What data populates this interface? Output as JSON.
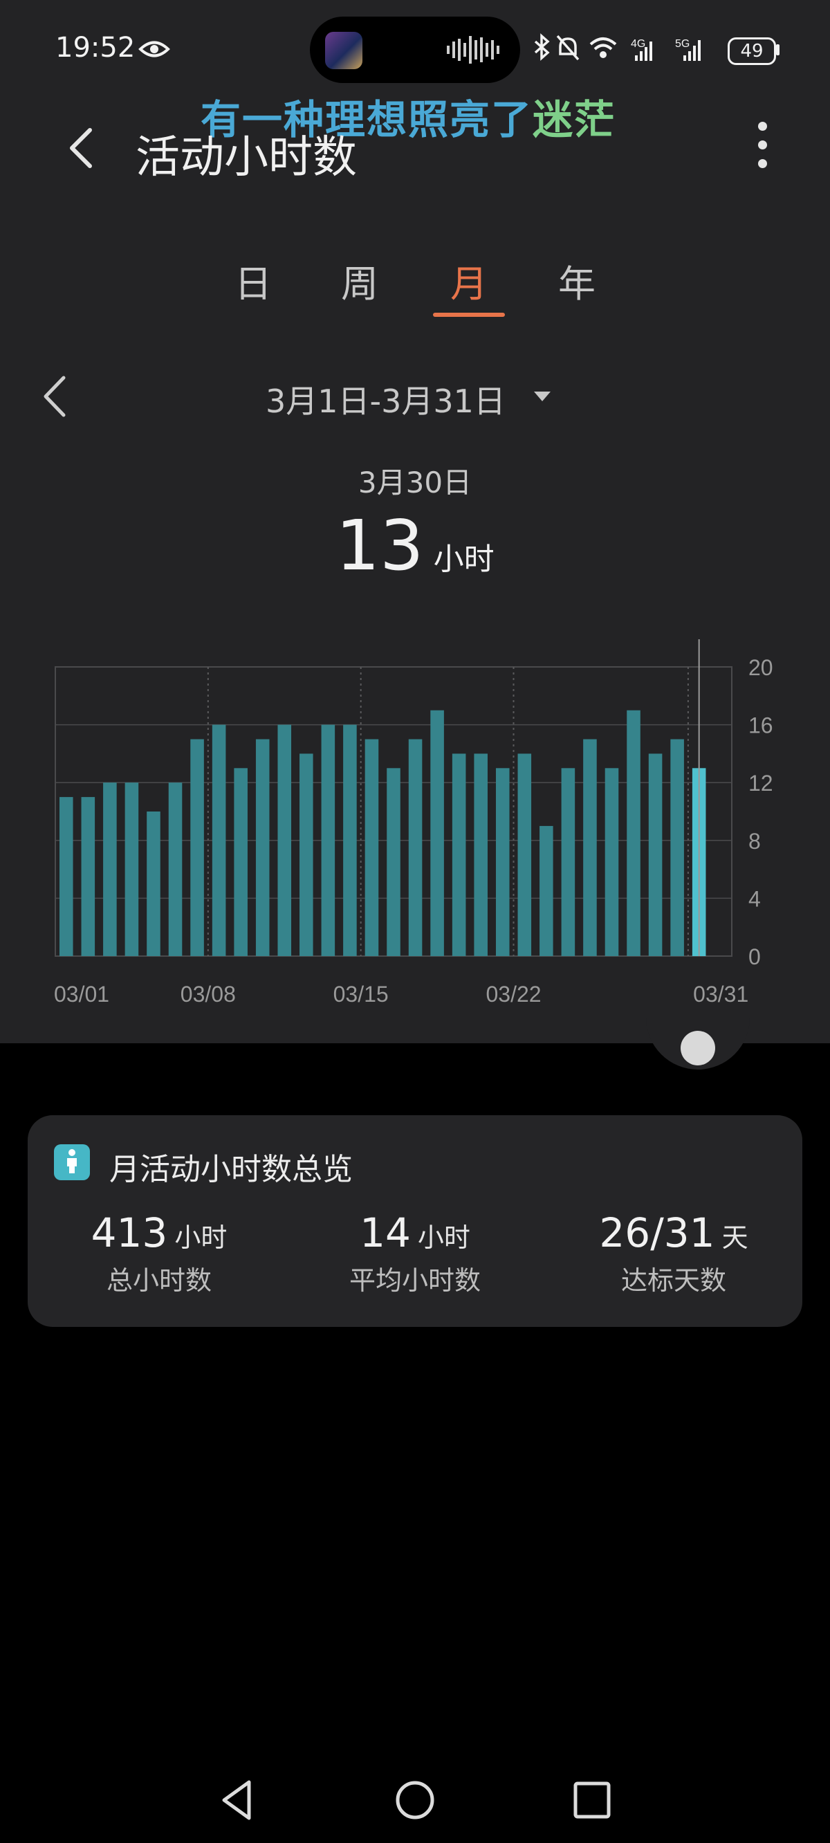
{
  "status_bar": {
    "time": "19:52",
    "battery": "49",
    "network_1": "4G",
    "network_2": "5G"
  },
  "lyric": {
    "main": "有一种理想照亮了",
    "tail": "迷茫"
  },
  "header": {
    "title": "活动小时数"
  },
  "tabs": [
    {
      "label": "日"
    },
    {
      "label": "周"
    },
    {
      "label": "月"
    },
    {
      "label": "年"
    }
  ],
  "active_tab": "月",
  "range": {
    "label": "3月1日-3月31日"
  },
  "selection": {
    "date": "3月30日",
    "value": "13",
    "unit": "小时"
  },
  "chart_data": {
    "type": "bar",
    "x": [
      "03/01",
      "03/02",
      "03/03",
      "03/04",
      "03/05",
      "03/06",
      "03/07",
      "03/08",
      "03/09",
      "03/10",
      "03/11",
      "03/12",
      "03/13",
      "03/14",
      "03/15",
      "03/16",
      "03/17",
      "03/18",
      "03/19",
      "03/20",
      "03/21",
      "03/22",
      "03/23",
      "03/24",
      "03/25",
      "03/26",
      "03/27",
      "03/28",
      "03/29",
      "03/30",
      "03/31"
    ],
    "values": [
      11,
      11,
      12,
      12,
      10,
      12,
      15,
      16,
      13,
      15,
      16,
      14,
      16,
      16,
      15,
      13,
      15,
      17,
      14,
      14,
      13,
      14,
      9,
      13,
      15,
      13,
      17,
      14,
      15,
      13,
      0
    ],
    "x_tick_labels": [
      "03/01",
      "03/08",
      "03/15",
      "03/22",
      "03/31"
    ],
    "y_ticks": [
      "20",
      "16",
      "12",
      "8",
      "4",
      "0"
    ],
    "ylim": [
      0,
      20
    ],
    "selected": "03/30",
    "grid": true,
    "colors": {
      "bar": "#36848c",
      "selected_bar": "#4fc1ce",
      "grid": "#4a4a4c"
    }
  },
  "summary": {
    "title": "月活动小时数总览",
    "total": {
      "value": "413",
      "unit": "小时",
      "label": "总小时数"
    },
    "average": {
      "value": "14",
      "unit": "小时",
      "label": "平均小时数"
    },
    "goal": {
      "value": "26/31",
      "unit": "天",
      "label": "达标天数"
    }
  },
  "colors": {
    "accent": "#e8744a",
    "panel": "#232325",
    "card": "#252527",
    "icon": "#46b7c6"
  }
}
